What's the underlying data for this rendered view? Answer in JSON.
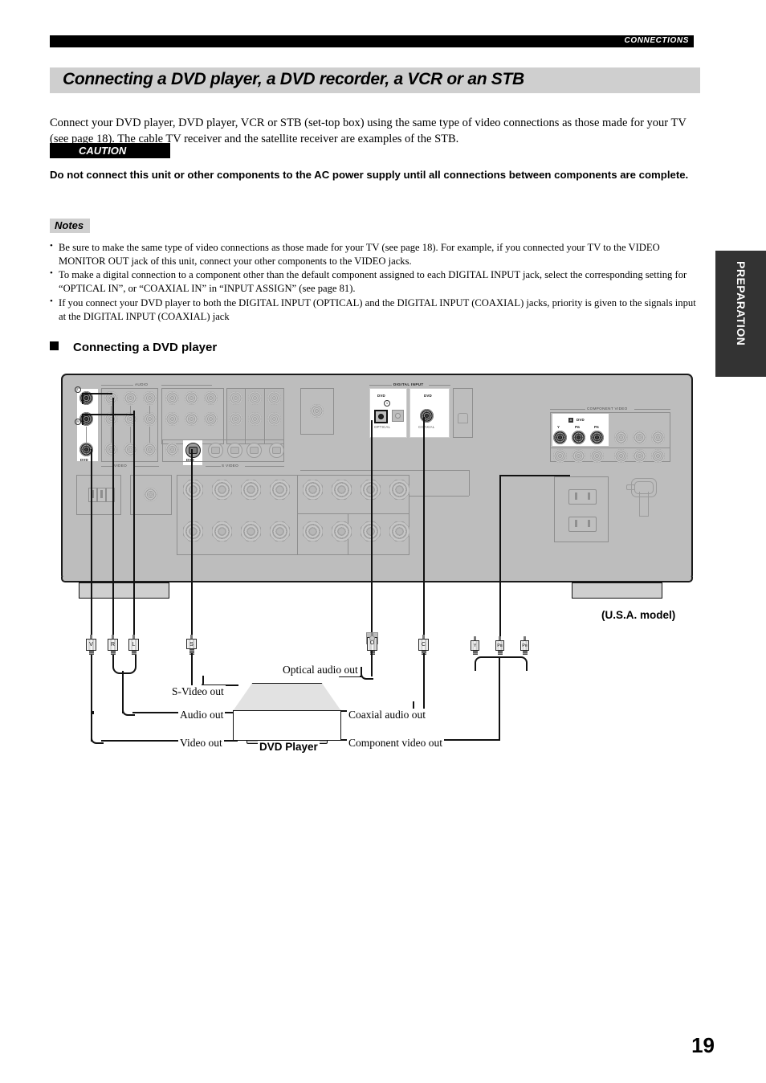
{
  "header": {
    "section_label": "CONNECTIONS"
  },
  "title": "Connecting a DVD player, a DVD recorder, a VCR or an STB",
  "intro": "Connect your DVD player, DVD player, VCR or STB (set-top box) using the same type of video connections as those made for your TV (see page 18). The cable TV receiver and the satellite receiver are examples of the STB.",
  "caution": {
    "tag": "CAUTION",
    "body": "Do not connect this unit or other components to the AC power supply until all connections between components are complete."
  },
  "notes": {
    "tag": "Notes",
    "items": [
      "Be sure to make the same type of video connections as those made for your TV (see page 18). For example, if you connected your TV to the VIDEO MONITOR OUT jack of this unit, connect your other components to the VIDEO jacks.",
      "To make a digital connection to a component other than the default component assigned to each DIGITAL INPUT jack, select the corresponding setting for “OPTICAL IN”, or “COAXIAL IN” in “INPUT ASSIGN” (see page 81).",
      "If you connect your DVD player to both the DIGITAL INPUT (OPTICAL) and the DIGITAL INPUT (COAXIAL) jacks, priority is given to the signals input at the DIGITAL INPUT (COAXIAL) jack"
    ]
  },
  "subheading": "Connecting a DVD player",
  "side_tab": {
    "label": "PREPARATION"
  },
  "page_number": "19",
  "diagram": {
    "model_note": "(U.S.A. model)",
    "device_label": "DVD Player",
    "panel_sections": {
      "audio": "AUDIO",
      "video": "VIDEO",
      "s_video": "S VIDEO",
      "digital_input": "DIGITAL INPUT",
      "component_video": "COMPONENT VIDEO"
    },
    "jack_labels": {
      "audio_left": "L",
      "audio_right": "R",
      "audio_dvd": "DVD",
      "video_dvd": "DVD",
      "svideo_dvd": "DVD",
      "digital_optical_dvd": "DVD",
      "digital_optical_num": "1",
      "digital_optical": "OPTICAL",
      "digital_coaxial_dvd": "DVD",
      "digital_coaxial": "COAXIAL",
      "component_a": "A",
      "component_dvd": "DVD",
      "component_y": "Y",
      "component_pb": "Pʙ",
      "component_pr": "Pʀ"
    },
    "plugs": [
      {
        "id": "video",
        "label": "V"
      },
      {
        "id": "right",
        "label": "R"
      },
      {
        "id": "left",
        "label": "L"
      },
      {
        "id": "svideo",
        "label": "S"
      },
      {
        "id": "optical",
        "label": "O"
      },
      {
        "id": "coaxial",
        "label": "C"
      },
      {
        "id": "comp-y",
        "label": "Y"
      },
      {
        "id": "comp-pb",
        "label": "Pʙ"
      },
      {
        "id": "comp-pr",
        "label": "Pʀ"
      }
    ],
    "cable_labels": {
      "optical_audio_out": "Optical audio out",
      "s_video_out": "S-Video out",
      "audio_out": "Audio out",
      "video_out": "Video out",
      "coaxial_audio_out": "Coaxial audio out",
      "component_video_out": "Component video out"
    }
  },
  "colors": {
    "header_bar": "#000000",
    "title_band": "#cfcfcf",
    "side_tab": "#333333",
    "panel": "#bdbdbd",
    "cable": "#111111"
  }
}
